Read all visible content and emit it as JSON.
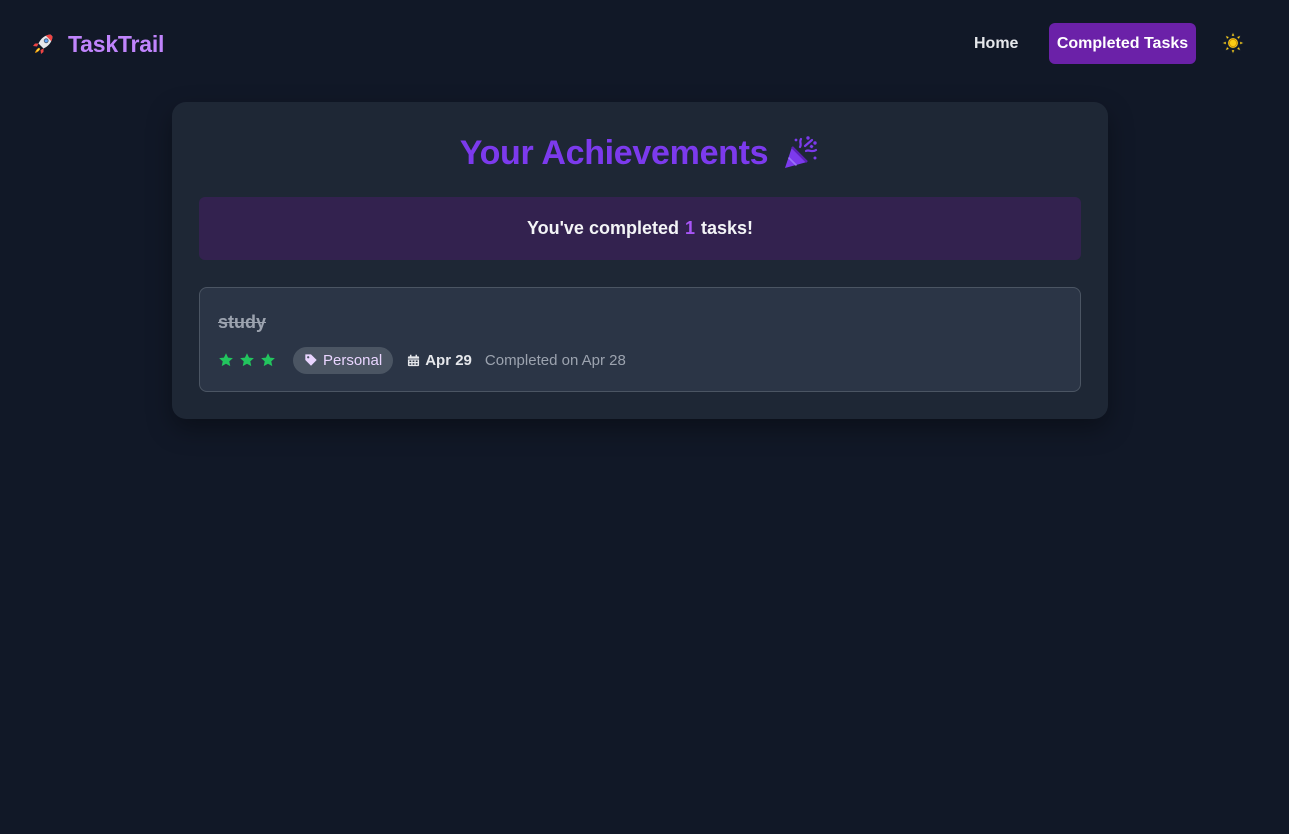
{
  "brand": {
    "name": "TaskTrail",
    "icon": "rocket-icon"
  },
  "nav": {
    "home_label": "Home",
    "completed_label": "Completed Tasks",
    "theme_icon": "sun-icon"
  },
  "page": {
    "title": "Your Achievements",
    "title_icon": "party-popper-icon",
    "summary_prefix": "You've completed",
    "summary_count": "1",
    "summary_suffix": "tasks!"
  },
  "tasks": [
    {
      "title": "study",
      "priority_stars": 3,
      "category": "Personal",
      "due_date": "Apr 29",
      "completed_text": "Completed on Apr 28"
    }
  ],
  "colors": {
    "background": "#111827",
    "card": "#1e2735",
    "accent": "#7c3aed",
    "brand": "#c084fc",
    "active_nav": "#6b21a8",
    "star": "#22c55e",
    "sun": "#facc15"
  }
}
